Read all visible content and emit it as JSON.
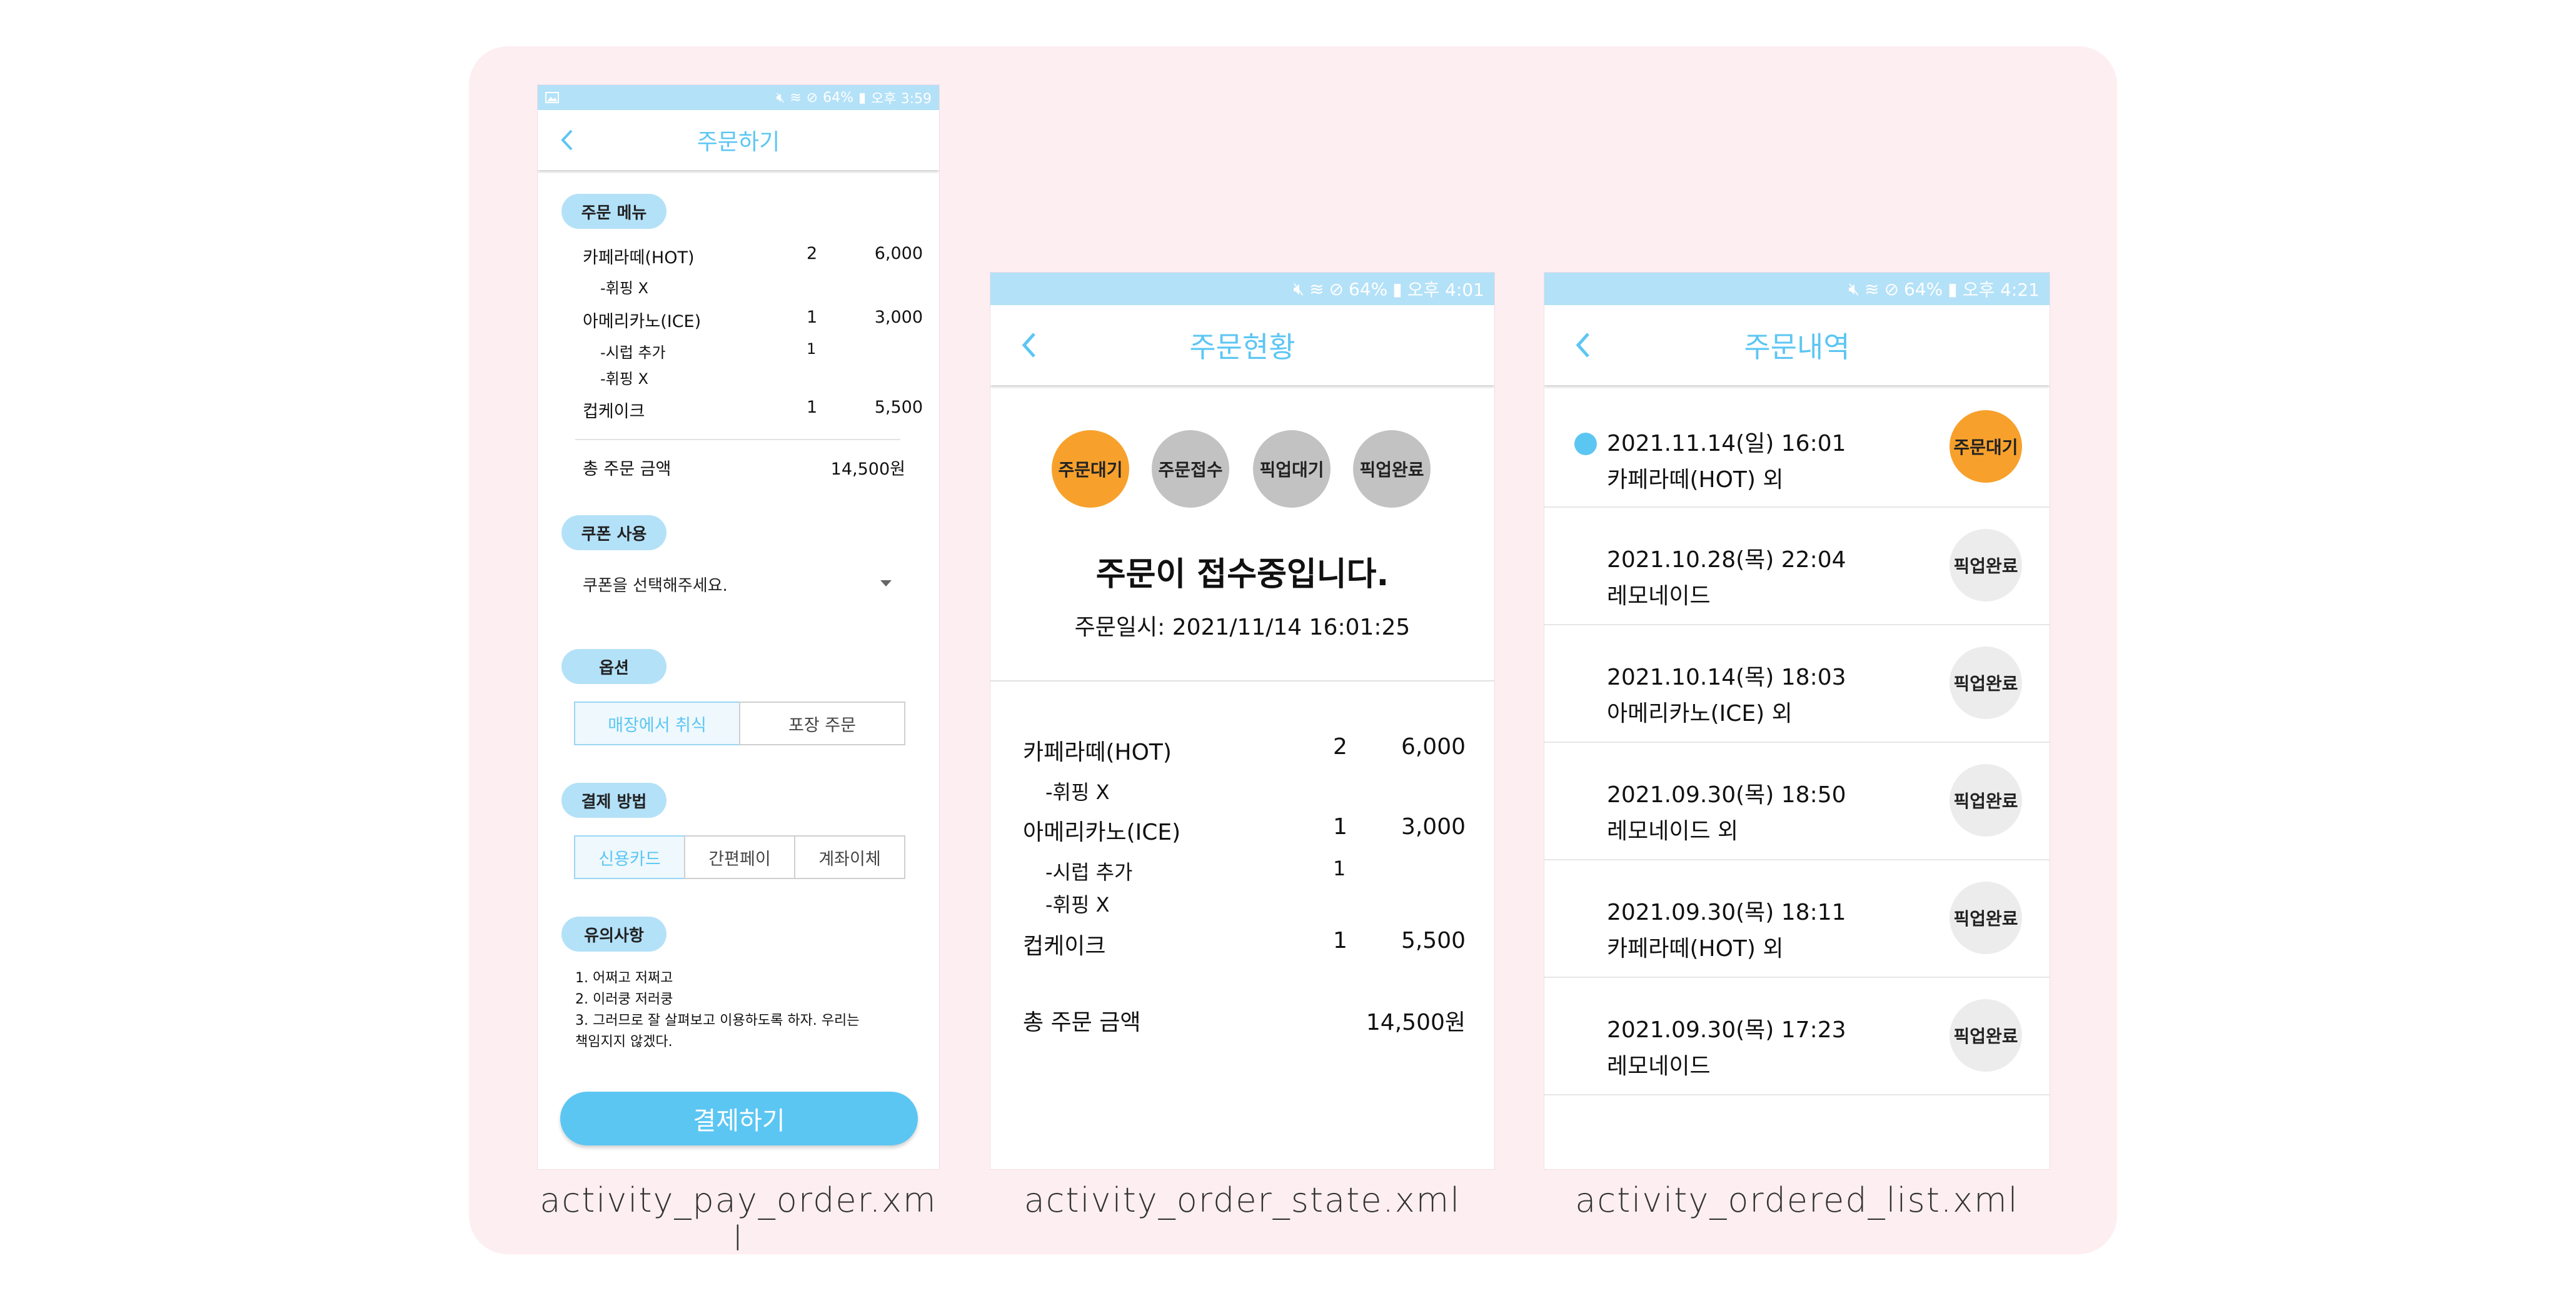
{
  "status": {
    "s1": {
      "battery": "64%",
      "time": "오후 3:59"
    },
    "s2": {
      "battery": "64%",
      "time": "오후 4:01"
    },
    "s3": {
      "battery": "64%",
      "time": "오후 4:21"
    }
  },
  "colors": {
    "accent": "#5cc6f3",
    "pill": "#b3e1f8",
    "orange": "#f7a12c",
    "gray_circle": "#c2c2c2",
    "light_circle": "#ececec",
    "background": "#fdeef1"
  },
  "pay_order": {
    "title": "주문하기",
    "section_menu": "주문 메뉴",
    "items": [
      {
        "name": "카페라떼(HOT)",
        "qty": "2",
        "price": "6,000"
      },
      {
        "name": "-휘핑 X",
        "qty": "",
        "price": ""
      },
      {
        "name": "아메리카노(ICE)",
        "qty": "1",
        "price": "3,000"
      },
      {
        "name": "-시럽 추가",
        "qty": "1",
        "price": ""
      },
      {
        "name": "-휘핑 X",
        "qty": "",
        "price": ""
      },
      {
        "name": "컵케이크",
        "qty": "1",
        "price": "5,500"
      }
    ],
    "total_label": "총 주문 금액",
    "total_value": "14,500원",
    "section_coupon": "쿠폰 사용",
    "coupon_placeholder": "쿠폰을 선택해주세요.",
    "section_option": "옵션",
    "options": [
      "매장에서 취식",
      "포장 주문"
    ],
    "section_payment": "결제 방법",
    "payments": [
      "신용카드",
      "간편페이",
      "계좌이체"
    ],
    "section_notice": "유의사항",
    "notice_lines": [
      "1. 어쩌고 저쩌고",
      "2. 이러쿵 저러쿵",
      "3. 그러므로 잘 살펴보고 이용하도록 하자. 우리는",
      "책임지지 않겠다."
    ],
    "pay_button": "결제하기"
  },
  "order_state": {
    "title": "주문현황",
    "steps": [
      "주문대기",
      "주문접수",
      "픽업대기",
      "픽업완료"
    ],
    "message": "주문이 접수중입니다.",
    "order_time": "주문일시: 2021/11/14 16:01:25",
    "items": [
      {
        "name": "카페라떼(HOT)",
        "qty": "2",
        "price": "6,000"
      },
      {
        "name": "-휘핑 X",
        "qty": "",
        "price": ""
      },
      {
        "name": "아메리카노(ICE)",
        "qty": "1",
        "price": "3,000"
      },
      {
        "name": "-시럽 추가",
        "qty": "1",
        "price": ""
      },
      {
        "name": "-휘핑 X",
        "qty": "",
        "price": ""
      },
      {
        "name": "컵케이크",
        "qty": "1",
        "price": "5,500"
      }
    ],
    "total_label": "총 주문 금액",
    "total_value": "14,500원"
  },
  "ordered_list": {
    "title": "주문내역",
    "orders": [
      {
        "date": "2021.11.14(일) 16:01",
        "desc": "카페라떼(HOT) 외",
        "status": "주문대기"
      },
      {
        "date": "2021.10.28(목) 22:04",
        "desc": "레모네이드",
        "status": "픽업완료"
      },
      {
        "date": "2021.10.14(목) 18:03",
        "desc": "아메리카노(ICE) 외",
        "status": "픽업완료"
      },
      {
        "date": "2021.09.30(목) 18:50",
        "desc": "레모네이드 외",
        "status": "픽업완료"
      },
      {
        "date": "2021.09.30(목) 18:11",
        "desc": "카페라떼(HOT) 외",
        "status": "픽업완료"
      },
      {
        "date": "2021.09.30(목) 17:23",
        "desc": "레모네이드",
        "status": "픽업완료"
      }
    ]
  },
  "captions": {
    "c1_line1": "activity_pay_order.xm",
    "c1_line2": "l",
    "c2": "activity_order_state.xml",
    "c3": "activity_ordered_list.xml"
  }
}
